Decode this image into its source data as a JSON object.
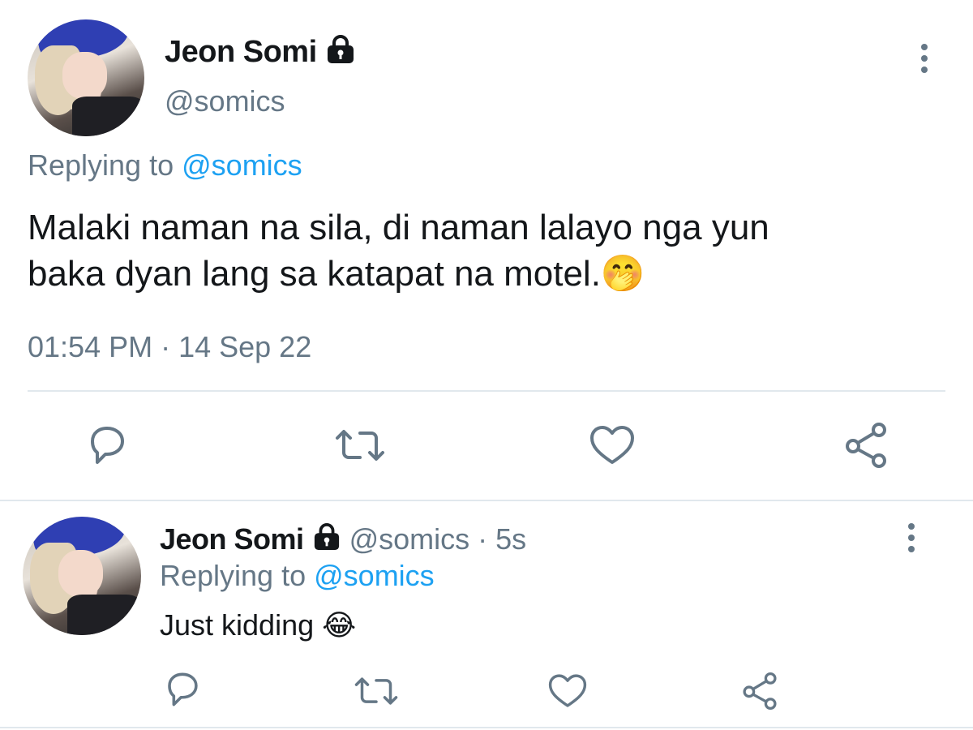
{
  "main_tweet": {
    "display_name": "Jeon Somi",
    "handle": "@somics",
    "replying_prefix": "Replying to",
    "replying_to": "@somics",
    "text_line1": "Malaki naman na sila, di naman lalayo nga yun",
    "text_line2": "baka dyan lang sa katapat na motel.",
    "emoji": "🤭",
    "timestamp": "01:54 PM · 14 Sep 22"
  },
  "reply_tweet": {
    "display_name": "Jeon Somi",
    "handle_time": "@somics · 5s",
    "replying_prefix": "Replying to",
    "replying_to": "@somics",
    "text": "Just kidding",
    "emoji": "😂"
  },
  "actions": {
    "reply_icon": "reply-icon",
    "retweet_icon": "retweet-icon",
    "like_icon": "heart-icon",
    "share_icon": "share-icon"
  },
  "colors": {
    "accent": "#1da1f2",
    "secondary_text": "#657786",
    "divider": "#e1e8ed"
  }
}
